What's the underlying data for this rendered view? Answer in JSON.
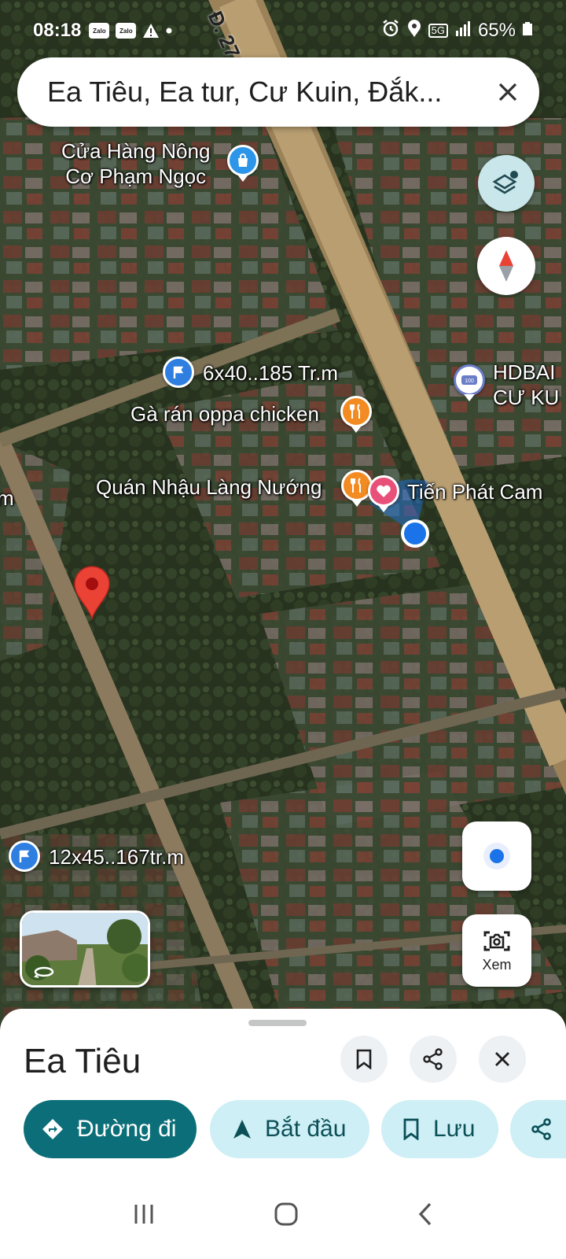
{
  "status_bar": {
    "time": "08:18",
    "app_badges": [
      "Zalo",
      "Zalo"
    ],
    "network": "5G",
    "battery": "65%"
  },
  "search": {
    "query": "Ea Tiêu, Ea tur, Cư Kuin, Đắk..."
  },
  "map": {
    "road_label": "Đ. 27",
    "pois": [
      {
        "label_line1": "Cửa Hàng Nông",
        "label_line2": "Cơ Phạm Ngọc",
        "icon": "shopping-bag-icon"
      },
      {
        "label": "6x40..185 Tr.m",
        "icon": "flag-icon"
      },
      {
        "label": "Gà rán oppa chicken",
        "icon": "restaurant-icon"
      },
      {
        "label": "Quán Nhậu Làng Nướng",
        "icon": "restaurant-icon"
      },
      {
        "label": "Tiến Phát Cam",
        "icon": "heart-icon"
      },
      {
        "label_line1": "HDBAI",
        "label_line2": "CƯ KU",
        "icon": "bank-icon"
      },
      {
        "label": "12x45..167tr.m",
        "icon": "flag-icon"
      },
      {
        "label": "m",
        "icon": ""
      }
    ],
    "lens_label": "Xem"
  },
  "place_sheet": {
    "title": "Ea Tiêu",
    "actions": [
      {
        "label": "Đường đi",
        "icon": "directions-icon"
      },
      {
        "label": "Bắt đầu",
        "icon": "navigation-arrow-icon"
      },
      {
        "label": "Lưu",
        "icon": "bookmark-icon"
      },
      {
        "label": "",
        "icon": "share-icon"
      }
    ]
  },
  "colors": {
    "primary": "#0b6e78",
    "tonal": "#cdeff5",
    "pin": "#ea4335",
    "location_dot": "#1a73e8"
  }
}
